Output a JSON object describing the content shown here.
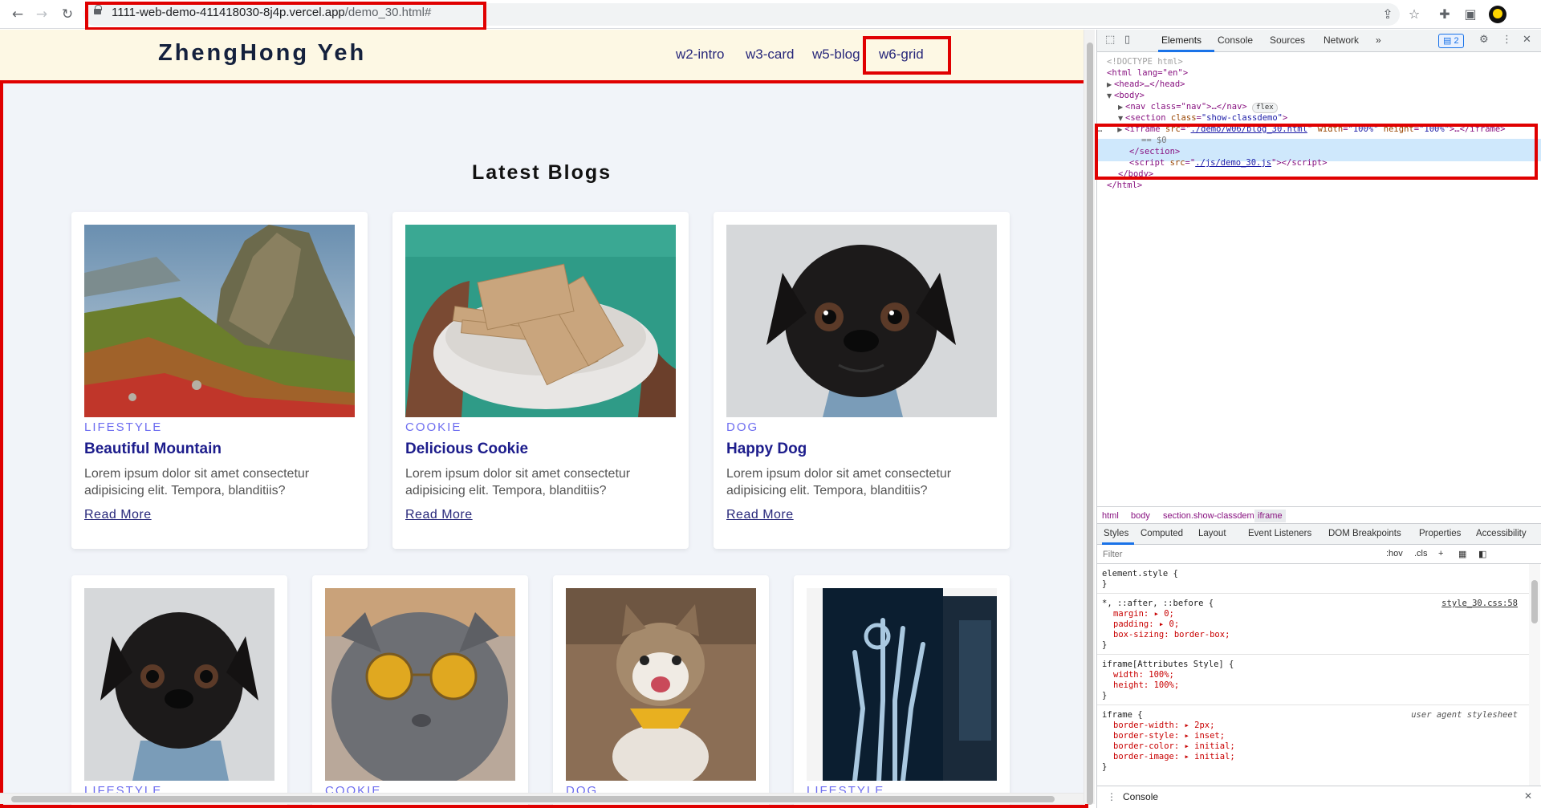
{
  "browser": {
    "url_host": "1111-web-demo-411418030-8j4p.vercel.app",
    "url_path": "/demo_30.html#",
    "icons": [
      "back-icon",
      "forward-icon",
      "reload-icon",
      "share-icon",
      "star-icon",
      "extensions-icon",
      "side-panel-icon",
      "profile-icon"
    ]
  },
  "site": {
    "logo": "ZhengHong Yeh",
    "nav": [
      "w2-intro",
      "w3-card",
      "w5-blog",
      "w6-grid"
    ],
    "section_title": "Latest Blogs",
    "cards_row1": [
      {
        "tag": "Lifestyle",
        "title": "Beautiful Mountain",
        "text": "Lorem ipsum dolor sit amet consectetur adipisicing elit. Tempora, blanditiis?",
        "link": "Read More"
      },
      {
        "tag": "Cookie",
        "title": "Delicious Cookie",
        "text": "Lorem ipsum dolor sit amet consectetur adipisicing elit. Tempora, blanditiis?",
        "link": "Read More"
      },
      {
        "tag": "Dog",
        "title": "Happy Dog",
        "text": "Lorem ipsum dolor sit amet consectetur adipisicing elit. Tempora, blanditiis?",
        "link": "Read More"
      }
    ],
    "cards_row2": [
      {
        "tag": "Lifestyle"
      },
      {
        "tag": "Cookie"
      },
      {
        "tag": "Dog"
      },
      {
        "tag": "Lifestyle"
      }
    ]
  },
  "devtools": {
    "tabs": [
      "Elements",
      "Console",
      "Sources",
      "Network"
    ],
    "more": "»",
    "issues_count": "2",
    "dom": {
      "doctype": "<!DOCTYPE html>",
      "html_open": "<html lang=\"en\">",
      "head": "<head>…</head>",
      "body_open": "<body>",
      "nav": "<nav class=\"nav\">…</nav>",
      "nav_pill": "flex",
      "section_open_tag": "<section",
      "section_attr": "class",
      "section_val": "\"show-classdemo\"",
      "iframe_tag": "<iframe",
      "iframe_src_attr": "src",
      "iframe_src": "./demo/w06/blog_30.html",
      "iframe_width": "\"100%\"",
      "iframe_height": "\"100%\"",
      "iframe_close": ">…</iframe>",
      "dollar": "== $0",
      "section_close": "</section>",
      "script_src": "./js/demo_30.js",
      "body_close": "</body>",
      "html_close": "</html>"
    },
    "breadcrumb": [
      "html",
      "body",
      "section.show-classdemo",
      "iframe"
    ],
    "style_tabs": [
      "Styles",
      "Computed",
      "Layout",
      "Event Listeners",
      "DOM Breakpoints",
      "Properties",
      "Accessibility"
    ],
    "filter_placeholder": "Filter",
    "filter_tools": [
      ":hov",
      ".cls",
      "+"
    ],
    "rules": {
      "element_style": "element.style {",
      "universal_selector": "*, ::after, ::before {",
      "universal_src": "style_30.css:58",
      "universal_props": [
        "margin: ▸ 0;",
        "padding: ▸ 0;",
        "box-sizing: border-box;"
      ],
      "iframe_attr_selector": "iframe[Attributes Style] {",
      "iframe_attr_props": [
        "width: 100%;",
        "height: 100%;"
      ],
      "iframe_ua_selector": "iframe {",
      "iframe_ua_src": "user agent stylesheet",
      "iframe_ua_props": [
        "border-width: ▸ 2px;",
        "border-style: ▸ inset;",
        "border-color: ▸ initial;",
        "border-image: ▸ initial;"
      ],
      "close": "}"
    },
    "console_label": "Console"
  }
}
